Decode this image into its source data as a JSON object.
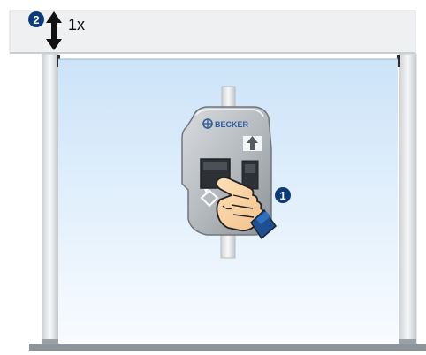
{
  "labels": {
    "step_top": "2",
    "step_right": "1",
    "times": "1x",
    "brand": "BECKER"
  },
  "icons": {
    "updown": "up-down-arrow-icon",
    "upArrow": "up-arrow-icon",
    "diamond": "diamond-arrow-icon",
    "hand": "pressing-hand-icon",
    "logo": "becker-logo-icon"
  },
  "colors": {
    "badge": "#0d3b7a",
    "frame": "#e9ecee",
    "frameStroke": "#d5d9dc",
    "screenTop": "#cfe6fa",
    "screenBottom": "#f7fbff",
    "device": "#a8adb2",
    "deviceDark": "#757b80",
    "floor": "#8e959a"
  }
}
